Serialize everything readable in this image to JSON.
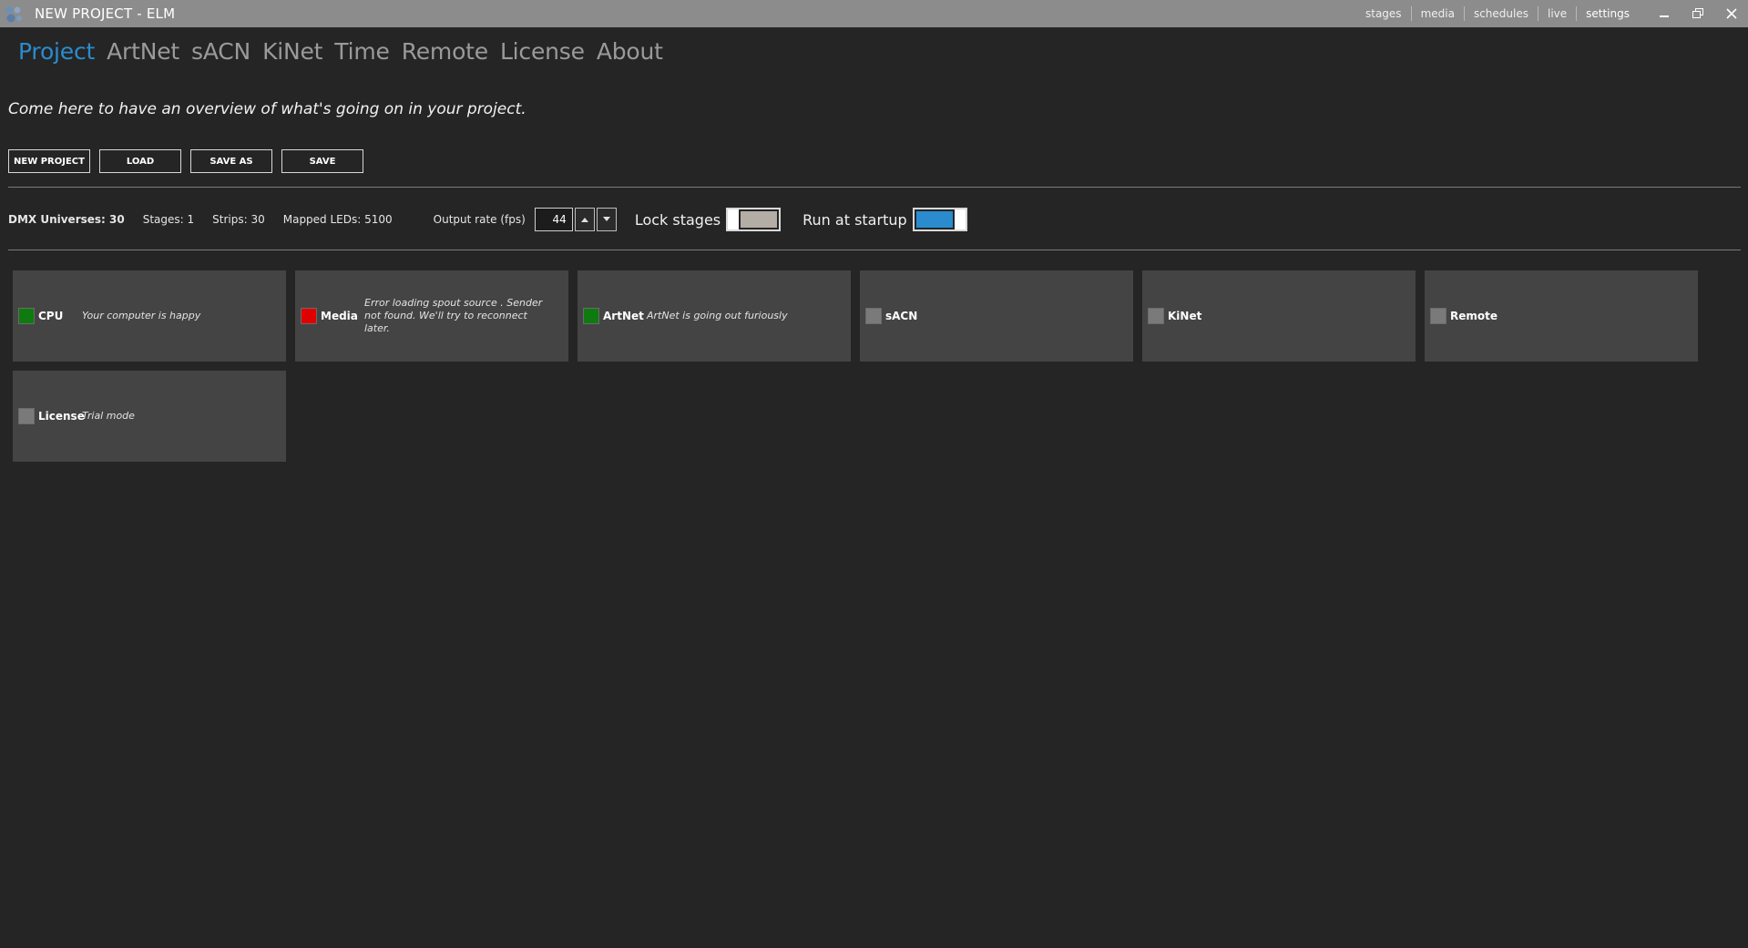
{
  "window": {
    "title": "NEW PROJECT - ELM",
    "nav": [
      "stages",
      "media",
      "schedules",
      "live",
      "settings"
    ],
    "active_nav": "settings"
  },
  "tabs": [
    "Project",
    "ArtNet",
    "sACN",
    "KiNet",
    "Time",
    "Remote",
    "License",
    "About"
  ],
  "active_tab": "Project",
  "overview_text": "Come here to have an overview of what's going on in your project.",
  "actions": {
    "new_project": "NEW PROJECT",
    "load": "LOAD",
    "save_as": "SAVE AS",
    "save": "SAVE"
  },
  "stats": {
    "dmx_universes": "DMX Universes: 30",
    "stages": "Stages: 1",
    "strips": "Strips: 30",
    "mapped_leds": "Mapped LEDs: 5100",
    "output_rate_label": "Output rate (fps)",
    "output_rate_value": "44",
    "lock_stages_label": "Lock stages",
    "lock_stages_on": false,
    "run_at_startup_label": "Run at startup",
    "run_at_startup_on": true
  },
  "status_cards": [
    {
      "name": "CPU",
      "message": "Your computer is happy",
      "status": "ok"
    },
    {
      "name": "Media",
      "message": "Error loading spout source . Sender not found. We'll try to reconnect later.",
      "status": "error"
    },
    {
      "name": "ArtNet",
      "message": "ArtNet is going out furiously",
      "status": "ok"
    },
    {
      "name": "sACN",
      "message": "",
      "status": "inactive"
    },
    {
      "name": "KiNet",
      "message": "",
      "status": "inactive"
    },
    {
      "name": "Remote",
      "message": "",
      "status": "inactive"
    },
    {
      "name": "License",
      "message": "Trial mode",
      "status": "inactive"
    }
  ],
  "colors": {
    "accent": "#2a8ccf",
    "ok": "#0f7a0f",
    "error": "#e00000",
    "inactive": "#7a7a7a",
    "toggle_off": "#b3ada5",
    "toggle_on": "#2a8ccf"
  }
}
